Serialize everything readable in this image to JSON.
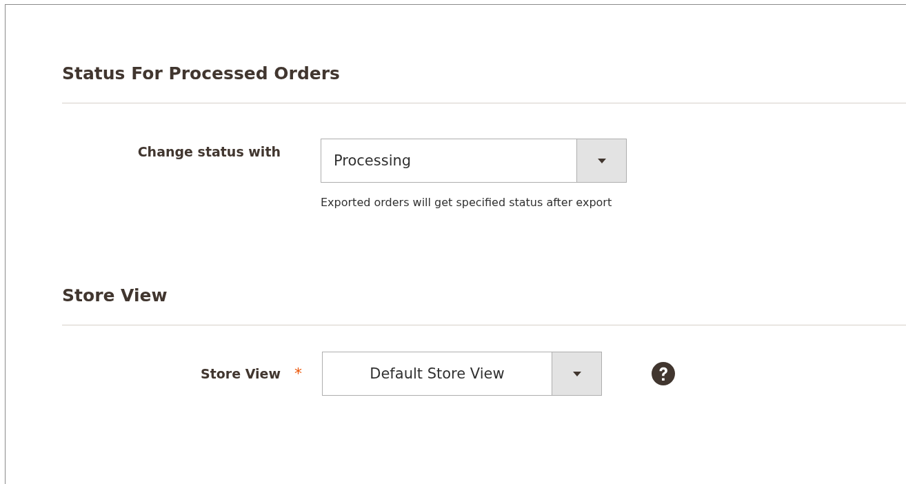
{
  "sections": [
    {
      "title": "Status For Processed Orders",
      "fields": [
        {
          "label": "Change status with",
          "value": "Processing",
          "note": "Exported orders will get specified status after export"
        }
      ]
    },
    {
      "title": "Store View",
      "fields": [
        {
          "label": "Store View",
          "required_mark": "*",
          "value": "Default Store View",
          "help": true
        }
      ]
    }
  ]
}
